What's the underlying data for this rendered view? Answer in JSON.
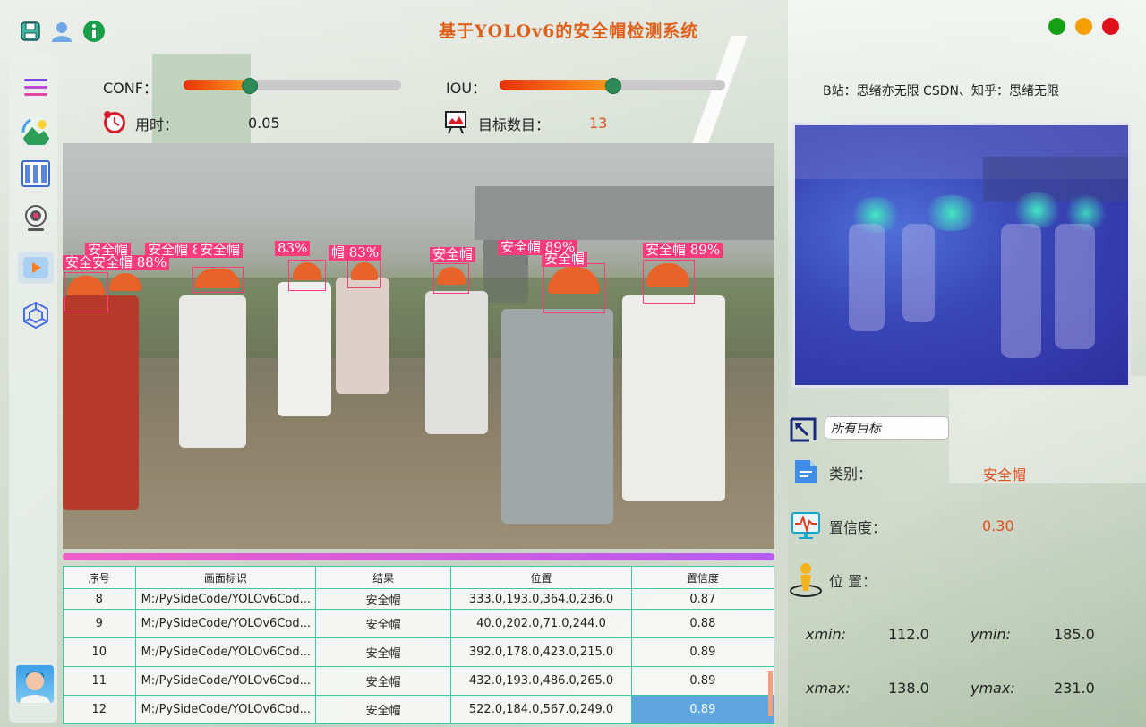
{
  "window": {
    "title": "基于YOLOv6的安全帽检测系统",
    "controls": {
      "close_color": "#e0101a",
      "minimize_color": "#f5a000",
      "maximize_color": "#16a016"
    }
  },
  "toolbar_icons": [
    "save-icon",
    "user-icon",
    "info-icon"
  ],
  "sidebar": {
    "items": [
      {
        "name": "menu-icon"
      },
      {
        "name": "image-icon"
      },
      {
        "name": "folder-icon"
      },
      {
        "name": "camera-icon"
      },
      {
        "name": "video-icon",
        "active": true
      },
      {
        "name": "model-icon"
      }
    ]
  },
  "params": {
    "conf_label": "CONF：",
    "conf_value": 0.3,
    "iou_label": "IOU：",
    "iou_value": 0.5,
    "time_label": "用时：",
    "time_value": "0.05",
    "count_label": "目标数目：",
    "count_value": "13"
  },
  "credits": "B站：思绪亦无限  CSDN、知乎：思绪无限",
  "detections": [
    {
      "label": "安全帽"
    },
    {
      "label": "安全帽 8"
    },
    {
      "label": "安全帽"
    },
    {
      "label": "83%"
    },
    {
      "label": "帽 83%"
    },
    {
      "label": "安全帽"
    },
    {
      "label": "安全帽 89%"
    },
    {
      "label": "安全帽 89%"
    },
    {
      "label": "安全安全帽 88%"
    },
    {
      "label": "安全帽"
    }
  ],
  "table": {
    "headers": [
      "序号",
      "画面标识",
      "结果",
      "位置",
      "置信度"
    ],
    "rows": [
      [
        "8",
        "M:/PySideCode/YOLOv6Cod...",
        "安全帽",
        "333.0,193.0,364.0,236.0",
        "0.87"
      ],
      [
        "9",
        "M:/PySideCode/YOLOv6Cod...",
        "安全帽",
        "40.0,202.0,71.0,244.0",
        "0.88"
      ],
      [
        "10",
        "M:/PySideCode/YOLOv6Cod...",
        "安全帽",
        "392.0,178.0,423.0,215.0",
        "0.89"
      ],
      [
        "11",
        "M:/PySideCode/YOLOv6Cod...",
        "安全帽",
        "432.0,193.0,486.0,265.0",
        "0.89"
      ],
      [
        "12",
        "M:/PySideCode/YOLOv6Cod...",
        "安全帽",
        "522.0,184.0,567.0,249.0",
        "0.89"
      ]
    ]
  },
  "details": {
    "target_select": "所有目标",
    "class_label": "类别：",
    "class_value": "安全帽",
    "conf_label": "置信度：",
    "conf_value": "0.30",
    "pos_label": "位 置：",
    "xmin_label": "xmin:",
    "xmin_value": "112.0",
    "ymin_label": "ymin:",
    "ymin_value": "185.0",
    "xmax_label": "xmax:",
    "xmax_value": "138.0",
    "ymax_label": "ymax:",
    "ymax_value": "231.0"
  }
}
